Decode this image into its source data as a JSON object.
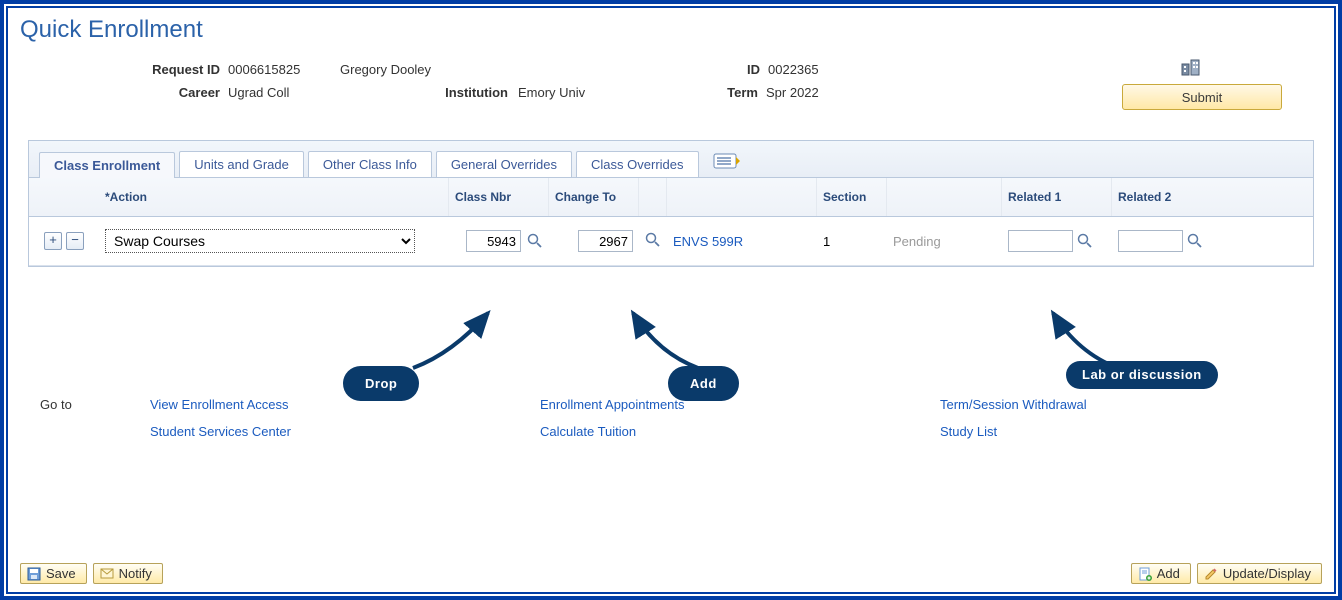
{
  "page": {
    "title": "Quick Enrollment"
  },
  "header": {
    "request_id_label": "Request ID",
    "request_id": "0006615825",
    "student_name": "Gregory Dooley",
    "id_label": "ID",
    "id": "0022365",
    "career_label": "Career",
    "career": "Ugrad Coll",
    "institution_label": "Institution",
    "institution": "Emory Univ",
    "term_label": "Term",
    "term": "Spr 2022",
    "submit_label": "Submit"
  },
  "tabs": {
    "class_enrollment": "Class Enrollment",
    "units_grade": "Units and Grade",
    "other_class": "Other Class Info",
    "gen_overrides": "General Overrides",
    "class_overrides": "Class Overrides"
  },
  "grid": {
    "headers": {
      "action": "*Action",
      "class_nbr": "Class Nbr",
      "change_to": "Change To",
      "section": "Section",
      "related1": "Related 1",
      "related2": "Related 2"
    },
    "row": {
      "action_selected": "Swap Courses",
      "class_nbr": "5943",
      "change_to": "2967",
      "course": "ENVS 599R",
      "section": "1",
      "status": "Pending",
      "related1": "",
      "related2": ""
    }
  },
  "callouts": {
    "drop": "Drop",
    "add": "Add",
    "lab": "Lab or discussion"
  },
  "goto": {
    "label": "Go to",
    "links": {
      "view_enroll_access": "View Enrollment Access",
      "enroll_appts": "Enrollment Appointments",
      "term_withdrawal": "Term/Session Withdrawal",
      "ssc": "Student Services Center",
      "calc_tuition": "Calculate Tuition",
      "study_list": "Study List"
    }
  },
  "toolbar": {
    "save": "Save",
    "notify": "Notify",
    "add": "Add",
    "update_display": "Update/Display"
  }
}
